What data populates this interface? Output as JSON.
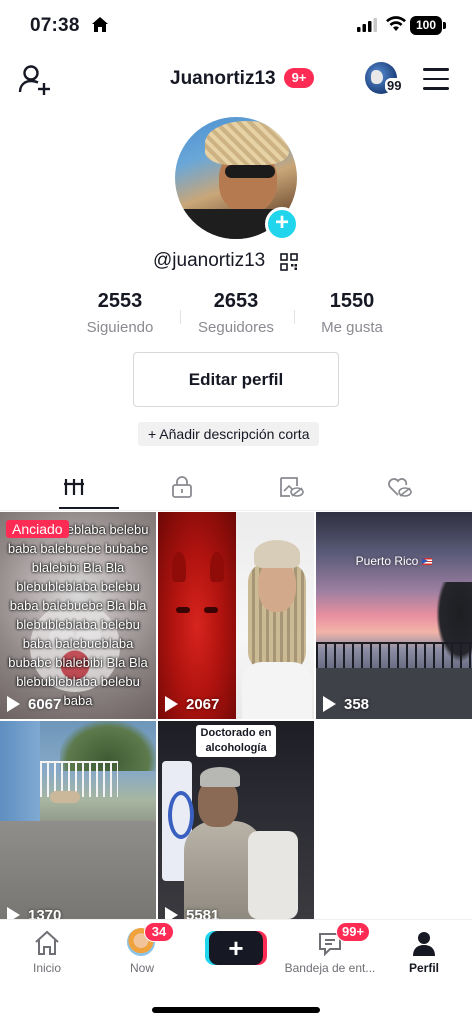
{
  "status_bar": {
    "time": "07:38",
    "battery": "100"
  },
  "header": {
    "username": "Juanortiz13",
    "notification_badge": "9+",
    "globe_count": "99"
  },
  "profile": {
    "handle": "@juanortiz13"
  },
  "stats": [
    {
      "value": "2553",
      "label": "Siguiendo"
    },
    {
      "value": "2653",
      "label": "Seguidores"
    },
    {
      "value": "1550",
      "label": "Me gusta"
    }
  ],
  "actions": {
    "edit_profile": "Editar perfil",
    "add_description": "+ Añadir descripción corta"
  },
  "tabs": [
    "videos-grid-icon",
    "lock-icon",
    "tagged-hidden-icon",
    "liked-hidden-icon"
  ],
  "videos": [
    {
      "views": "6067",
      "pinned_label": "Anciado",
      "overlay_text": "bleblebubleblaba belebu baba balebuebe bubabe blalebibi Bla Bla blebubleblaba belebu baba balebuebe Bla bla blebubleblaba belebu baba balebueblaba bubabe blalebibi Bla Bla blebubleblaba belebu baba"
    },
    {
      "views": "2067"
    },
    {
      "views": "358",
      "overlay_text": "Puerto Rico"
    },
    {
      "views": "1370"
    },
    {
      "views": "5581",
      "overlay_text": "Doctorado en alcohología"
    }
  ],
  "bottom_nav": {
    "items": [
      {
        "label": "Inicio"
      },
      {
        "label": "Now",
        "badge": "34"
      },
      {
        "label": ""
      },
      {
        "label": "Bandeja de ent...",
        "badge": "99+"
      },
      {
        "label": "Perfil"
      }
    ]
  },
  "colors": {
    "accent": "#fe2c55",
    "cyan": "#20d5ec",
    "text": "#161823",
    "muted": "#8a8b91"
  }
}
